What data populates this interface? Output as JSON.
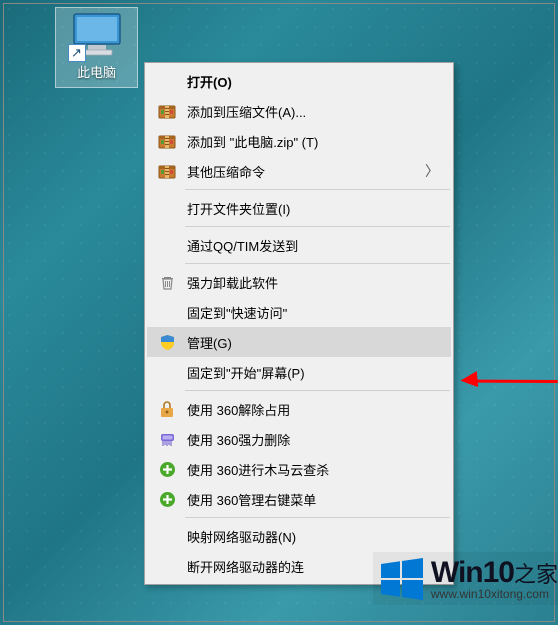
{
  "desktop_icon": {
    "label": "此电脑"
  },
  "menu": {
    "open": "打开(O)",
    "add_archive": "添加到压缩文件(A)...",
    "add_zip": "添加到 \"此电脑.zip\" (T)",
    "other_compress": "其他压缩命令",
    "open_folder_loc": "打开文件夹位置(I)",
    "send_qq_tim": "通过QQ/TIM发送到",
    "force_uninstall": "强力卸载此软件",
    "pin_quick_access": "固定到\"快速访问\"",
    "manage": "管理(G)",
    "pin_start": "固定到\"开始\"屏幕(P)",
    "use_360_unlock": "使用 360解除占用",
    "use_360_force_del": "使用 360强力删除",
    "use_360_trojan_scan": "使用 360进行木马云查杀",
    "use_360_rc_menu": "使用 360管理右键菜单",
    "map_net_drive": "映射网络驱动器(N)",
    "disconnect_net_drive": "断开网络驱动器的连"
  },
  "watermark": {
    "main": "Win10",
    "suffix": "之家",
    "url": "www.win10xitong.com"
  }
}
